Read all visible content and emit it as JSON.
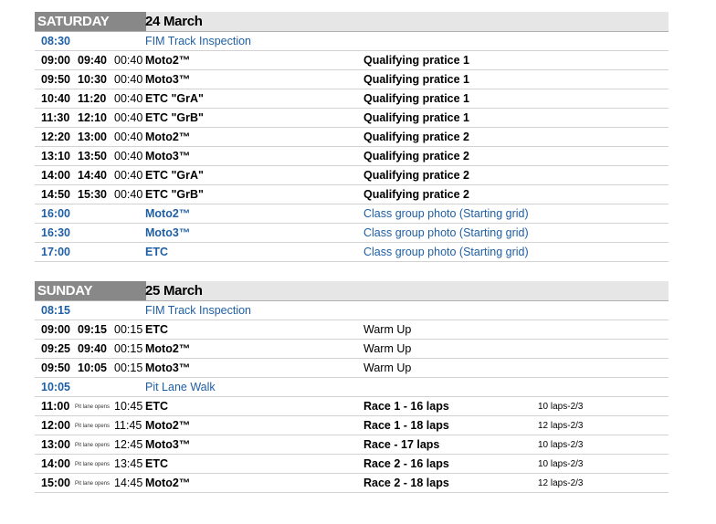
{
  "saturday": {
    "day": "SATURDAY",
    "date": "24 March",
    "rows": [
      {
        "start": "08:30",
        "title": "FIM Track Inspection",
        "kind": "info"
      },
      {
        "start": "09:00",
        "end": "09:40",
        "dur": "00:40",
        "cls": "Moto2™",
        "event": "Qualifying pratice 1",
        "kind": "session"
      },
      {
        "start": "09:50",
        "end": "10:30",
        "dur": "00:40",
        "cls": "Moto3™",
        "event": "Qualifying pratice 1",
        "kind": "session"
      },
      {
        "start": "10:40",
        "end": "11:20",
        "dur": "00:40",
        "cls": "ETC \"GrA\"",
        "event": "Qualifying pratice 1",
        "kind": "session"
      },
      {
        "start": "11:30",
        "end": "12:10",
        "dur": "00:40",
        "cls": "ETC \"GrB\"",
        "event": "Qualifying pratice 1",
        "kind": "session"
      },
      {
        "start": "12:20",
        "end": "13:00",
        "dur": "00:40",
        "cls": "Moto2™",
        "event": "Qualifying pratice 2",
        "kind": "session"
      },
      {
        "start": "13:10",
        "end": "13:50",
        "dur": "00:40",
        "cls": "Moto3™",
        "event": "Qualifying pratice 2",
        "kind": "session"
      },
      {
        "start": "14:00",
        "end": "14:40",
        "dur": "00:40",
        "cls": "ETC \"GrA\"",
        "event": "Qualifying pratice 2",
        "kind": "session"
      },
      {
        "start": "14:50",
        "end": "15:30",
        "dur": "00:40",
        "cls": "ETC \"GrB\"",
        "event": "Qualifying pratice 2",
        "kind": "session"
      },
      {
        "start": "16:00",
        "cls": "Moto2™",
        "event": "Class group photo (Starting grid)",
        "kind": "photo"
      },
      {
        "start": "16:30",
        "cls": "Moto3™",
        "event": "Class group photo (Starting grid)",
        "kind": "photo"
      },
      {
        "start": "17:00",
        "cls": "ETC",
        "event": "Class group photo (Starting grid)",
        "kind": "photo"
      }
    ]
  },
  "sunday": {
    "day": "SUNDAY",
    "date": "25 March",
    "rows": [
      {
        "start": "08:15",
        "title": "FIM Track Inspection",
        "kind": "info"
      },
      {
        "start": "09:00",
        "end": "09:15",
        "dur": "00:15",
        "cls": "ETC",
        "event": "Warm Up",
        "kind": "warmup"
      },
      {
        "start": "09:25",
        "end": "09:40",
        "dur": "00:15",
        "cls": "Moto2™",
        "event": "Warm Up",
        "kind": "warmup"
      },
      {
        "start": "09:50",
        "end": "10:05",
        "dur": "00:15",
        "cls": "Moto3™",
        "event": "Warm Up",
        "kind": "warmup"
      },
      {
        "start": "10:05",
        "title": "Pit Lane Walk",
        "kind": "info"
      },
      {
        "start": "11:00",
        "pit": "Pit lane opens",
        "end": "10:45",
        "cls": "ETC",
        "event": "Race 1 - 16 laps",
        "laps": "10 laps-2/3",
        "kind": "race"
      },
      {
        "start": "12:00",
        "pit": "Pit lane opens",
        "end": "11:45",
        "cls": "Moto2™",
        "event": "Race 1 - 18 laps",
        "laps": "12 laps-2/3",
        "kind": "race"
      },
      {
        "start": "13:00",
        "pit": "Pit lane opens",
        "end": "12:45",
        "cls": "Moto3™",
        "event": "Race - 17 laps",
        "laps": "10 laps-2/3",
        "kind": "race"
      },
      {
        "start": "14:00",
        "pit": "Pit lane opens",
        "end": "13:45",
        "cls": "ETC",
        "event": "Race 2 - 16 laps",
        "laps": "10 laps-2/3",
        "kind": "race"
      },
      {
        "start": "15:00",
        "pit": "Pit lane opens",
        "end": "14:45",
        "cls": "Moto2™",
        "event": "Race 2 - 18 laps",
        "laps": "12 laps-2/3",
        "kind": "race"
      }
    ]
  }
}
